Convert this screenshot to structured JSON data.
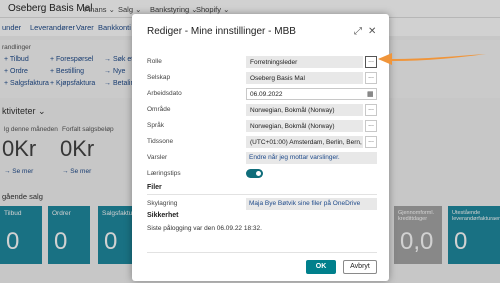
{
  "app": {
    "company": "Oseberg Basis Mal",
    "menu": [
      "Finans ⌄",
      "Salg ⌄",
      "Bankstyring ⌄",
      "Shopify ⌄"
    ],
    "nav": [
      "under",
      "Leverandører",
      "Varer",
      "Bankkonti"
    ],
    "actions_label": "randlinger",
    "actions_col1": [
      "+ Tilbud",
      "+ Ordre",
      "+ Salgsfaktura"
    ],
    "actions_col2": [
      "+ Forespørsel",
      "+ Bestilling",
      "+ Kjøpsfaktura"
    ],
    "actions_col3": [
      "→ Søk ette",
      "→ Nye",
      "→ Betalinge"
    ],
    "activities_title": "ktiviteter ⌄",
    "kpi": [
      {
        "label": "lg denne måneden",
        "value": "0Kr",
        "more": "→ Se mer"
      },
      {
        "label": "Forfalt salgsbeløp",
        "value": "0Kr",
        "more": "→ Se mer"
      }
    ],
    "sales_title": "gående salg",
    "tiles": [
      {
        "label": "Tilbud",
        "value": "0"
      },
      {
        "label": "Ordrer",
        "value": "0"
      },
      {
        "label": "Salgsfakturaer",
        "value": "0"
      },
      {
        "label": "Gjennomforml. kredittdager",
        "value": "0,0"
      },
      {
        "label": "Utestående leverandørfakturaer",
        "value": "0"
      }
    ]
  },
  "dialog": {
    "title": "Rediger - Mine innstillinger - MBB",
    "fields": {
      "role": {
        "label": "Rolle",
        "value": "Forretningsleder"
      },
      "company": {
        "label": "Selskap",
        "value": "Oseberg Basis Mal"
      },
      "workdate": {
        "label": "Arbeidsdato",
        "value": "06.09.2022"
      },
      "region": {
        "label": "Område",
        "value": "Norwegian, Bokmål (Norway)"
      },
      "language": {
        "label": "Språk",
        "value": "Norwegian, Bokmål (Norway)"
      },
      "timezone": {
        "label": "Tidssone",
        "value": "(UTC+01:00) Amsterdam, Berlin, Bern, Ro..."
      },
      "notifications": {
        "label": "Varsler",
        "value": "Endre når jeg mottar varslinger."
      },
      "teaching_tips": {
        "label": "Læringstips",
        "value": "on"
      }
    },
    "files_section": "Filer",
    "cloud": {
      "label": "Skylagring",
      "value": "Maja Bye Bøtvik sine filer på OneDrive"
    },
    "security_section": "Sikkerhet",
    "last_login": "Siste pålogging var den 06.09.22 18:32.",
    "ok_label": "OK",
    "cancel_label": "Avbryt",
    "dots": "...",
    "colors": {
      "accent": "#00808C",
      "arrow": "#F0953A"
    }
  }
}
